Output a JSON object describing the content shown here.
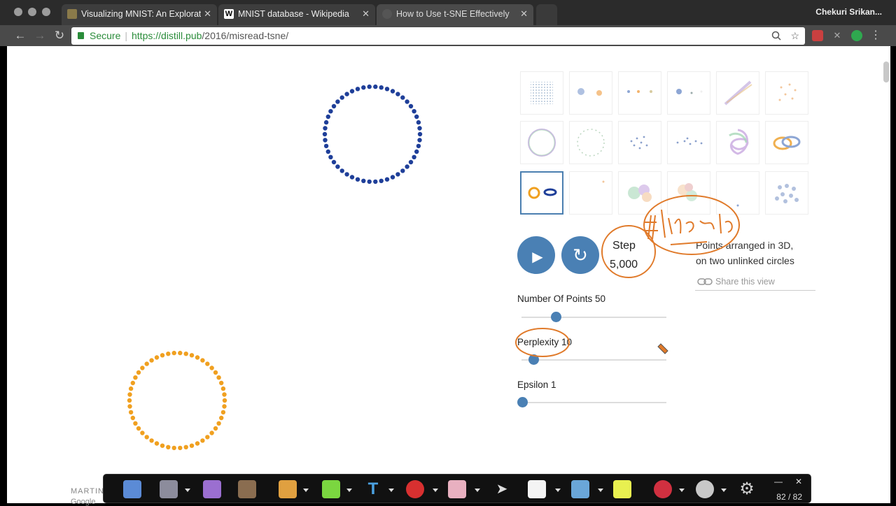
{
  "browser": {
    "tabs": [
      {
        "title": "Visualizing MNIST: An Explorat",
        "favicon_color": "#8a7a4a"
      },
      {
        "title": "MNIST database - Wikipedia",
        "favicon_color": "#ffffff"
      },
      {
        "title": "How to Use t-SNE Effectively",
        "favicon_color": "#666666"
      }
    ],
    "profile_name": "Chekuri Srikan...",
    "nav": {
      "back": "←",
      "forward": "→",
      "reload": "↻"
    },
    "omnibox": {
      "secure_label": "Secure",
      "url_scheme": "https://",
      "url_host": "distill.pub",
      "url_path": "/2016/misread-tsne/"
    },
    "omni_icons": {
      "zoom": "zoom-icon",
      "bookmark": "star-icon"
    },
    "menu": "⋮"
  },
  "page": {
    "controls": {
      "play_icon": "▶",
      "restart_icon": "↻",
      "step_label": "Step",
      "step_value": "5,000"
    },
    "description": {
      "line1": "Points arranged in 3D,",
      "line2": "on two unlinked circles"
    },
    "share_label": "Share this view",
    "sliders": [
      {
        "label": "Number Of Points 50",
        "value": 50
      },
      {
        "label": "Perplexity 10",
        "value": 10
      },
      {
        "label": "Epsilon 1",
        "value": 1
      }
    ],
    "byline": {
      "author_fragment": "MARTIN",
      "affiliation_fragment": "Google"
    },
    "annotation_text": "#iterations",
    "circles": {
      "blue_color": "#1f3f99",
      "orange_color": "#f0a020",
      "points_per_circle": 50
    }
  },
  "annotation_toolbar": {
    "page_counter": "82 / 82",
    "minimize": "—",
    "close": "✕"
  },
  "colors": {
    "accent": "#4a80b4",
    "annotation_ink": "#e07a2a"
  }
}
